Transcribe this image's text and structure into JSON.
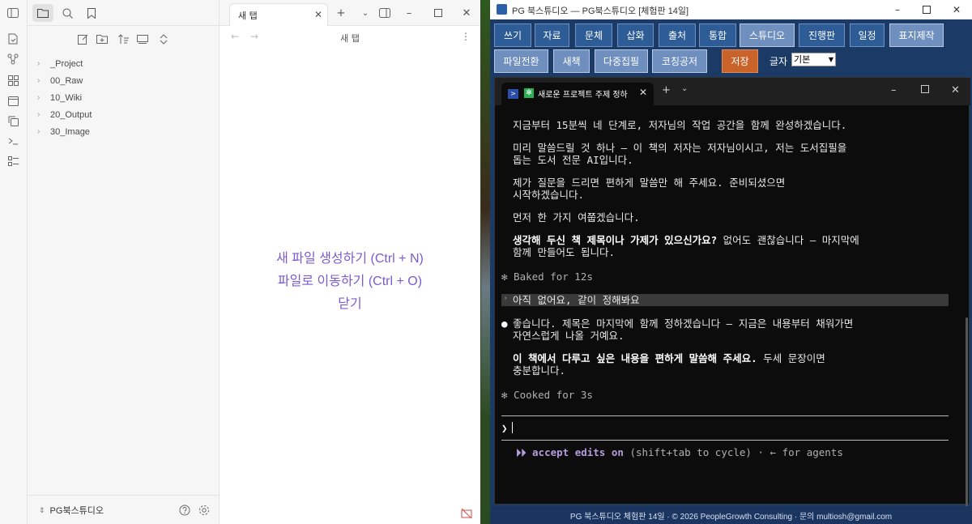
{
  "obsidian": {
    "tree": [
      "_Project",
      "00_Raw",
      "10_Wiki",
      "20_Output",
      "30_Image"
    ],
    "vault_name": "PG북스튜디오",
    "tab_label": "새 탭",
    "nav_title": "새 탭",
    "empty_actions": [
      "새 파일 생성하기 (Ctrl + N)",
      "파일로 이동하기 (Ctrl + O)",
      "닫기"
    ]
  },
  "pg": {
    "window_title": "PG 북스튜디오 — PG북스튜디오  [체험판 14일]",
    "toolbar_row1": [
      "쓰기",
      "자료",
      "문체",
      "삽화",
      "출처",
      "통합",
      "스튜디오",
      "진행판",
      "일정",
      "표지제작"
    ],
    "toolbar_row2": [
      "파일전환",
      "새책",
      "다중집필",
      "코칭공저"
    ],
    "save_label": "저장",
    "font_label": "글자",
    "font_value": "기본",
    "footer": "PG 북스튜디오 체험판 14일  ·  © 2026 PeopleGrowth Consulting  ·  문의 multiosh@gmail.com"
  },
  "terminal": {
    "tab_title": "새로운 프로젝트 주제 정하",
    "lines": [
      "지금부터 15분씩 네 단계로, 저자님의 작업 공간을 함께 완성하겠습니다.",
      "미리 말씀드릴 것 하나 — 이 책의 저자는 저자님이시고, 저는 도서집필을",
      "돕는 도서 전문 AI입니다.",
      "제가 질문을 드리면 편하게 말씀만 해 주세요. 준비되셨으면",
      "시작하겠습니다.",
      "먼저 한 가지 여쭙겠습니다.",
      "생각해 두신 책 제목이나 가제가 있으신가요?",
      " 없어도 괜찮습니다 — 마지막에",
      "함께 만들어도 됩니다."
    ],
    "baked": "✻ Baked for 12s",
    "user_msg": "아직 없어요, 같이 정해봐요",
    "reply": [
      "좋습니다. 제목은 마지막에 함께 정하겠습니다 — 지금은 내용부터 채워가면",
      "자연스럽게 나올 거예요.",
      "이 책에서 다루고 싶은 내용을 편하게 말씀해 주세요.",
      " 두세 문장이면",
      "충분합니다."
    ],
    "cooked": "✻ Cooked for 3s",
    "prompt": "❯",
    "accept_prefix": "⏵⏵ accept edits on",
    "accept_suffix": " (shift+tab to cycle) · ← for agents"
  }
}
